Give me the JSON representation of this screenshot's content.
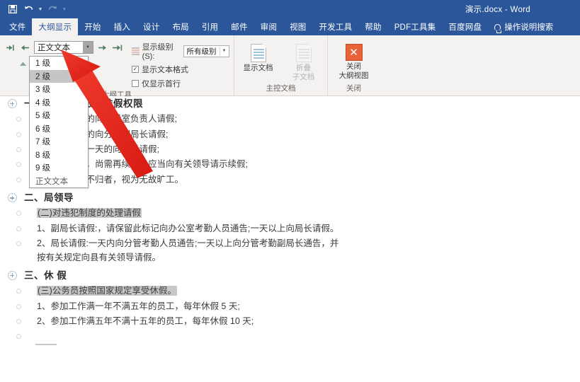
{
  "window": {
    "doc_title": "演示.docx  -  Word",
    "quick_access": [
      {
        "name": "save-icon",
        "glyph": "Ὃe"
      },
      {
        "name": "undo-icon",
        "glyph": "↶"
      },
      {
        "name": "redo-icon",
        "glyph": "↻"
      },
      {
        "name": "customize-qat-icon",
        "glyph": "▾"
      }
    ]
  },
  "ribbon": {
    "tabs": [
      {
        "label": "文件",
        "active": false
      },
      {
        "label": "大纲显示",
        "active": true
      },
      {
        "label": "开始",
        "active": false
      },
      {
        "label": "插入",
        "active": false
      },
      {
        "label": "设计",
        "active": false
      },
      {
        "label": "布局",
        "active": false
      },
      {
        "label": "引用",
        "active": false
      },
      {
        "label": "邮件",
        "active": false
      },
      {
        "label": "审阅",
        "active": false
      },
      {
        "label": "视图",
        "active": false
      },
      {
        "label": "开发工具",
        "active": false
      },
      {
        "label": "帮助",
        "active": false
      },
      {
        "label": "PDF工具集",
        "active": false
      },
      {
        "label": "百度网盘",
        "active": false
      }
    ],
    "tell_me": "操作说明搜索",
    "groups": {
      "outline_tools": {
        "label": "大纲工具",
        "promote_to_heading1_icon": "promote-to-heading1-icon",
        "promote_icon": "promote-icon",
        "demote_icon": "demote-icon",
        "demote_to_body_icon": "demote-to-body-icon",
        "move_up_icon": "move-up-icon",
        "move_down_icon": "move-down-icon",
        "level_value": "正文文本",
        "show_level_label": "显示级别(S):",
        "show_level_value": "所有级别",
        "show_text_formatting_label": "显示文本格式",
        "show_text_formatting_checked": true,
        "show_first_line_only_label": "仅显示首行",
        "show_first_line_only_checked": false
      },
      "master_document": {
        "label": "主控文档",
        "show_document_label": "显示文档",
        "collapse_subdocuments_label": "折叠\n子文档",
        "collapse_subdocuments_line1": "折叠",
        "collapse_subdocuments_line2": "子文档"
      },
      "close": {
        "label": "关闭",
        "close_outline_view_line1": "关闭",
        "close_outline_view_line2": "大纲视图",
        "close_icon_glyph": "✕",
        "close_icon_color": "#e8633a"
      }
    }
  },
  "dropdown": {
    "open": true,
    "selected": "2 级",
    "items": [
      "1 级",
      "2 级",
      "3 级",
      "4 级",
      "5 级",
      "6 级",
      "7 级",
      "8 级",
      "9 级",
      "正文文本"
    ]
  },
  "document": {
    "lines": [
      {
        "marker": "plus",
        "indent": 0,
        "style": "heading1",
        "text": "一、请假的权限与准假权限",
        "highlight": false
      },
      {
        "marker": "dot",
        "indent": 1,
        "style": "body",
        "text": "1、一天以内的向本股室负责人请假;",
        "highlight": false
      },
      {
        "marker": "dot",
        "indent": 1,
        "style": "body",
        "text": "2、三天以内的向分管副局长请假;",
        "highlight": false
      },
      {
        "marker": "dot",
        "indent": 1,
        "style": "body",
        "text": "3、三天以上一天的向局长请假;",
        "highlight": false
      },
      {
        "marker": "dot",
        "indent": 1,
        "style": "body",
        "text": "4、请假期满，尚需再续者，应当向有关领导请示续假;",
        "highlight": false
      },
      {
        "marker": "dot",
        "indent": 1,
        "style": "body",
        "text": "5、请假期满不归者，视为无故旷工。",
        "highlight": false
      },
      {
        "marker": "plus",
        "indent": 0,
        "style": "heading1",
        "text": "二、局领导",
        "highlight": false
      },
      {
        "marker": "dot",
        "indent": 1,
        "style": "body",
        "text": "(二)对违犯制度的处理请假",
        "highlight": true
      },
      {
        "marker": "dot",
        "indent": 1,
        "style": "body",
        "text": "1、副局长请假:，请保留此标记向办公室考勤人员通告;一天以上向局长请假。",
        "highlight": false
      },
      {
        "marker": "dot",
        "indent": 1,
        "style": "body",
        "text": "2、局长请假:一天内向分管考勤人员通告;一天以上向分管考勤副局长通告，并按有关规定向县有关领导请假。",
        "highlight": false
      },
      {
        "marker": "plus",
        "indent": 0,
        "style": "heading1",
        "text": "三、休 假",
        "highlight": false
      },
      {
        "marker": "dot",
        "indent": 1,
        "style": "body",
        "text": "(三)公务员按照国家规定享受休假。",
        "highlight": true
      },
      {
        "marker": "dot",
        "indent": 1,
        "style": "body",
        "text": "1、参加工作满一年不满五年的员工，每年休假 5 天;",
        "highlight": false
      },
      {
        "marker": "dot",
        "indent": 1,
        "style": "body",
        "text": "2、参加工作满五年不满十五年的员工，每年休假 10 天;",
        "highlight": false
      },
      {
        "marker": "dot",
        "indent": 1,
        "style": "body",
        "text": "",
        "highlight": false
      }
    ]
  },
  "annotation": {
    "arrow_name": "red-pointer-arrow",
    "arrow_color": "#e8251b",
    "points_to": "2 级"
  },
  "colors": {
    "brand": "#2b579a",
    "ribbon_bg": "#f3f2f1",
    "highlight": "#c8c8c8",
    "accent_orange": "#e8633a",
    "annotation_red": "#e8251b"
  }
}
